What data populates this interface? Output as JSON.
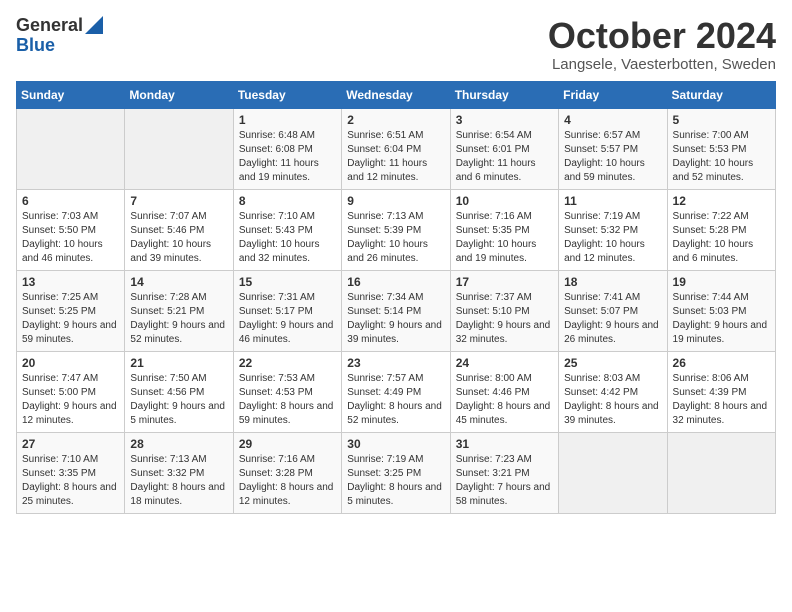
{
  "header": {
    "logo_general": "General",
    "logo_blue": "Blue",
    "month": "October 2024",
    "location": "Langsele, Vaesterbotten, Sweden"
  },
  "weekdays": [
    "Sunday",
    "Monday",
    "Tuesday",
    "Wednesday",
    "Thursday",
    "Friday",
    "Saturday"
  ],
  "weeks": [
    [
      null,
      null,
      {
        "day": 1,
        "sunrise": "Sunrise: 6:48 AM",
        "sunset": "Sunset: 6:08 PM",
        "daylight": "Daylight: 11 hours and 19 minutes."
      },
      {
        "day": 2,
        "sunrise": "Sunrise: 6:51 AM",
        "sunset": "Sunset: 6:04 PM",
        "daylight": "Daylight: 11 hours and 12 minutes."
      },
      {
        "day": 3,
        "sunrise": "Sunrise: 6:54 AM",
        "sunset": "Sunset: 6:01 PM",
        "daylight": "Daylight: 11 hours and 6 minutes."
      },
      {
        "day": 4,
        "sunrise": "Sunrise: 6:57 AM",
        "sunset": "Sunset: 5:57 PM",
        "daylight": "Daylight: 10 hours and 59 minutes."
      },
      {
        "day": 5,
        "sunrise": "Sunrise: 7:00 AM",
        "sunset": "Sunset: 5:53 PM",
        "daylight": "Daylight: 10 hours and 52 minutes."
      }
    ],
    [
      {
        "day": 6,
        "sunrise": "Sunrise: 7:03 AM",
        "sunset": "Sunset: 5:50 PM",
        "daylight": "Daylight: 10 hours and 46 minutes."
      },
      {
        "day": 7,
        "sunrise": "Sunrise: 7:07 AM",
        "sunset": "Sunset: 5:46 PM",
        "daylight": "Daylight: 10 hours and 39 minutes."
      },
      {
        "day": 8,
        "sunrise": "Sunrise: 7:10 AM",
        "sunset": "Sunset: 5:43 PM",
        "daylight": "Daylight: 10 hours and 32 minutes."
      },
      {
        "day": 9,
        "sunrise": "Sunrise: 7:13 AM",
        "sunset": "Sunset: 5:39 PM",
        "daylight": "Daylight: 10 hours and 26 minutes."
      },
      {
        "day": 10,
        "sunrise": "Sunrise: 7:16 AM",
        "sunset": "Sunset: 5:35 PM",
        "daylight": "Daylight: 10 hours and 19 minutes."
      },
      {
        "day": 11,
        "sunrise": "Sunrise: 7:19 AM",
        "sunset": "Sunset: 5:32 PM",
        "daylight": "Daylight: 10 hours and 12 minutes."
      },
      {
        "day": 12,
        "sunrise": "Sunrise: 7:22 AM",
        "sunset": "Sunset: 5:28 PM",
        "daylight": "Daylight: 10 hours and 6 minutes."
      }
    ],
    [
      {
        "day": 13,
        "sunrise": "Sunrise: 7:25 AM",
        "sunset": "Sunset: 5:25 PM",
        "daylight": "Daylight: 9 hours and 59 minutes."
      },
      {
        "day": 14,
        "sunrise": "Sunrise: 7:28 AM",
        "sunset": "Sunset: 5:21 PM",
        "daylight": "Daylight: 9 hours and 52 minutes."
      },
      {
        "day": 15,
        "sunrise": "Sunrise: 7:31 AM",
        "sunset": "Sunset: 5:17 PM",
        "daylight": "Daylight: 9 hours and 46 minutes."
      },
      {
        "day": 16,
        "sunrise": "Sunrise: 7:34 AM",
        "sunset": "Sunset: 5:14 PM",
        "daylight": "Daylight: 9 hours and 39 minutes."
      },
      {
        "day": 17,
        "sunrise": "Sunrise: 7:37 AM",
        "sunset": "Sunset: 5:10 PM",
        "daylight": "Daylight: 9 hours and 32 minutes."
      },
      {
        "day": 18,
        "sunrise": "Sunrise: 7:41 AM",
        "sunset": "Sunset: 5:07 PM",
        "daylight": "Daylight: 9 hours and 26 minutes."
      },
      {
        "day": 19,
        "sunrise": "Sunrise: 7:44 AM",
        "sunset": "Sunset: 5:03 PM",
        "daylight": "Daylight: 9 hours and 19 minutes."
      }
    ],
    [
      {
        "day": 20,
        "sunrise": "Sunrise: 7:47 AM",
        "sunset": "Sunset: 5:00 PM",
        "daylight": "Daylight: 9 hours and 12 minutes."
      },
      {
        "day": 21,
        "sunrise": "Sunrise: 7:50 AM",
        "sunset": "Sunset: 4:56 PM",
        "daylight": "Daylight: 9 hours and 5 minutes."
      },
      {
        "day": 22,
        "sunrise": "Sunrise: 7:53 AM",
        "sunset": "Sunset: 4:53 PM",
        "daylight": "Daylight: 8 hours and 59 minutes."
      },
      {
        "day": 23,
        "sunrise": "Sunrise: 7:57 AM",
        "sunset": "Sunset: 4:49 PM",
        "daylight": "Daylight: 8 hours and 52 minutes."
      },
      {
        "day": 24,
        "sunrise": "Sunrise: 8:00 AM",
        "sunset": "Sunset: 4:46 PM",
        "daylight": "Daylight: 8 hours and 45 minutes."
      },
      {
        "day": 25,
        "sunrise": "Sunrise: 8:03 AM",
        "sunset": "Sunset: 4:42 PM",
        "daylight": "Daylight: 8 hours and 39 minutes."
      },
      {
        "day": 26,
        "sunrise": "Sunrise: 8:06 AM",
        "sunset": "Sunset: 4:39 PM",
        "daylight": "Daylight: 8 hours and 32 minutes."
      }
    ],
    [
      {
        "day": 27,
        "sunrise": "Sunrise: 7:10 AM",
        "sunset": "Sunset: 3:35 PM",
        "daylight": "Daylight: 8 hours and 25 minutes."
      },
      {
        "day": 28,
        "sunrise": "Sunrise: 7:13 AM",
        "sunset": "Sunset: 3:32 PM",
        "daylight": "Daylight: 8 hours and 18 minutes."
      },
      {
        "day": 29,
        "sunrise": "Sunrise: 7:16 AM",
        "sunset": "Sunset: 3:28 PM",
        "daylight": "Daylight: 8 hours and 12 minutes."
      },
      {
        "day": 30,
        "sunrise": "Sunrise: 7:19 AM",
        "sunset": "Sunset: 3:25 PM",
        "daylight": "Daylight: 8 hours and 5 minutes."
      },
      {
        "day": 31,
        "sunrise": "Sunrise: 7:23 AM",
        "sunset": "Sunset: 3:21 PM",
        "daylight": "Daylight: 7 hours and 58 minutes."
      },
      null,
      null
    ]
  ]
}
